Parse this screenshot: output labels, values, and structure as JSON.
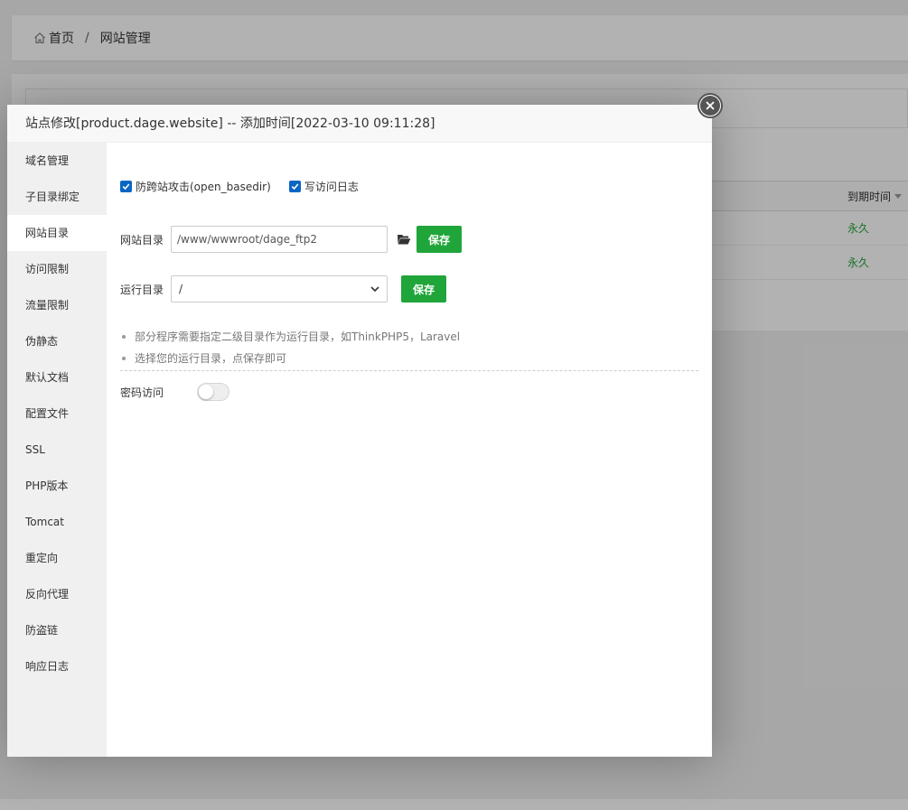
{
  "background": {
    "breadcrumb": {
      "home": "首页",
      "separator": "/",
      "current": "网站管理"
    },
    "table": {
      "expire_header": "到期时间",
      "rows": [
        {
          "expire": "永久"
        },
        {
          "expire": "永久"
        }
      ]
    }
  },
  "modal": {
    "title": "站点修改[product.dage.website] -- 添加时间[2022-03-10 09:11:28]",
    "nav": [
      {
        "label": "域名管理"
      },
      {
        "label": "子目录绑定"
      },
      {
        "label": "网站目录"
      },
      {
        "label": "访问限制"
      },
      {
        "label": "流量限制"
      },
      {
        "label": "伪静态"
      },
      {
        "label": "默认文档"
      },
      {
        "label": "配置文件"
      },
      {
        "label": "SSL"
      },
      {
        "label": "PHP版本"
      },
      {
        "label": "Tomcat"
      },
      {
        "label": "重定向"
      },
      {
        "label": "反向代理"
      },
      {
        "label": "防盗链"
      },
      {
        "label": "响应日志"
      }
    ],
    "active_nav": "网站目录",
    "checks": {
      "open_basedir": {
        "label": "防跨站攻击(open_basedir)",
        "checked": true
      },
      "access_log": {
        "label": "写访问日志",
        "checked": true
      }
    },
    "site_dir": {
      "label": "网站目录",
      "value": "/www/wwwroot/dage_ftp2",
      "save_label": "保存"
    },
    "run_dir": {
      "label": "运行目录",
      "value": "/",
      "save_label": "保存"
    },
    "tips": [
      "部分程序需要指定二级目录作为运行目录，如ThinkPHP5，Laravel",
      "选择您的运行目录，点保存即可"
    ],
    "password_access": {
      "label": "密码访问",
      "enabled": false
    }
  },
  "colors": {
    "accent": "#20a53a",
    "checkbox": "#0a66c2"
  }
}
